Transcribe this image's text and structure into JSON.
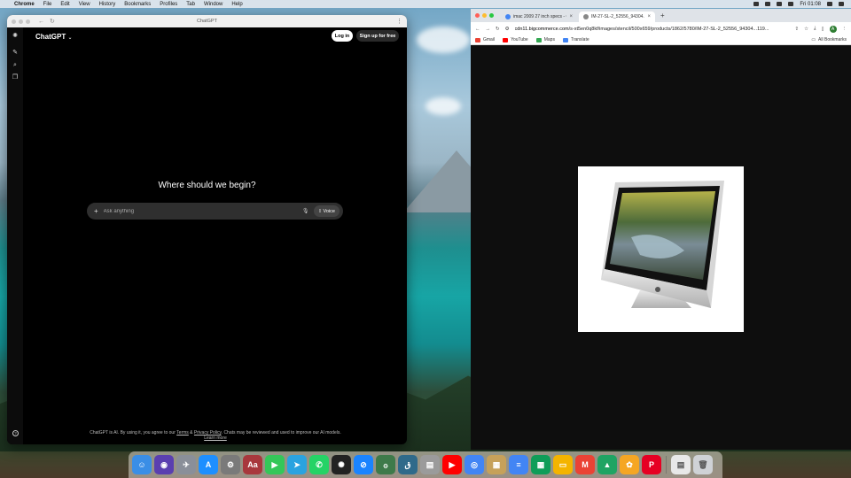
{
  "menubar": {
    "apple": "",
    "app_name": "Chrome",
    "items": [
      "File",
      "Edit",
      "View",
      "History",
      "Bookmarks",
      "Profiles",
      "Tab",
      "Window",
      "Help"
    ],
    "clock": "Fri 01:08"
  },
  "chatgpt_window": {
    "title": "ChatGPT",
    "model_label": "ChatGPT",
    "login_label": "Log in",
    "signup_label": "Sign up for free",
    "heading": "Where should we begin?",
    "input_placeholder": "Ask anything",
    "voice_label": "Voice",
    "footer": {
      "text_before": "ChatGPT is AI. By using it, you agree to our ",
      "terms": "Terms",
      "amp": " & ",
      "privacy": "Privacy Policy",
      "text_after": ". Chats may be reviewed and used to improve our AI models. ",
      "learn_more": "Learn more"
    }
  },
  "browser_window": {
    "tabs": [
      {
        "label": "imac 2009 27 inch specs - Go",
        "active": false
      },
      {
        "label": "IM-27-SL-2_52556_94304...",
        "active": true
      }
    ],
    "url_host": "cdn11.bigcommerce.com",
    "url_path": "/s-xt5en0q8kf/images/stencil/500x659/products/1862/5780/IM-27-SL-2_52556_94304...119...",
    "bookmarks": [
      {
        "label": "Gmail",
        "color": "#ea4335"
      },
      {
        "label": "YouTube",
        "color": "#ff0000"
      },
      {
        "label": "Maps",
        "color": "#34a853"
      },
      {
        "label": "Translate",
        "color": "#4285f4"
      }
    ],
    "all_bookmarks": "All Bookmarks",
    "profile_initial": "A"
  },
  "dock": {
    "apps": [
      {
        "name": "finder",
        "color": "#3a8ee6",
        "glyph": "☺"
      },
      {
        "name": "siri",
        "color": "#5a3fb0",
        "glyph": "◉"
      },
      {
        "name": "launchpad",
        "color": "#8a8f99",
        "glyph": "✈"
      },
      {
        "name": "app-store",
        "color": "#1e8fff",
        "glyph": "A"
      },
      {
        "name": "system-settings",
        "color": "#7a7a7a",
        "glyph": "⚙"
      },
      {
        "name": "dictionary",
        "color": "#a8383d",
        "glyph": "Aa"
      },
      {
        "name": "facetime",
        "color": "#34c759",
        "glyph": "▶"
      },
      {
        "name": "telegram",
        "color": "#2aa3e0",
        "glyph": "➤"
      },
      {
        "name": "whatsapp",
        "color": "#25d366",
        "glyph": "✆"
      },
      {
        "name": "chatgpt",
        "color": "#222222",
        "glyph": "✺"
      },
      {
        "name": "safari",
        "color": "#1a84ff",
        "glyph": "⊘"
      },
      {
        "name": "quran",
        "color": "#3e7a4a",
        "glyph": "۞"
      },
      {
        "name": "calligraphy",
        "color": "#2f6a8a",
        "glyph": "ق"
      },
      {
        "name": "notes-stack",
        "color": "#9b9b9b",
        "glyph": "▤"
      },
      {
        "name": "youtube",
        "color": "#ff0000",
        "glyph": "▶"
      },
      {
        "name": "chrome",
        "color": "#4285f4",
        "glyph": "◎"
      },
      {
        "name": "preview",
        "color": "#c6a15a",
        "glyph": "▦"
      },
      {
        "name": "google-docs",
        "color": "#4285f4",
        "glyph": "≡"
      },
      {
        "name": "google-sheets",
        "color": "#0f9d58",
        "glyph": "▦"
      },
      {
        "name": "google-slides",
        "color": "#f4b400",
        "glyph": "▭"
      },
      {
        "name": "gmail",
        "color": "#ea4335",
        "glyph": "M"
      },
      {
        "name": "google-drive",
        "color": "#1fa463",
        "glyph": "▲"
      },
      {
        "name": "photos",
        "color": "#f5a623",
        "glyph": "✿"
      },
      {
        "name": "pinterest",
        "color": "#e60023",
        "glyph": "P"
      },
      {
        "name": "document",
        "color": "#e8e8e8",
        "glyph": "▤"
      },
      {
        "name": "trash",
        "color": "#cfd2d6",
        "glyph": "🗑"
      }
    ]
  }
}
